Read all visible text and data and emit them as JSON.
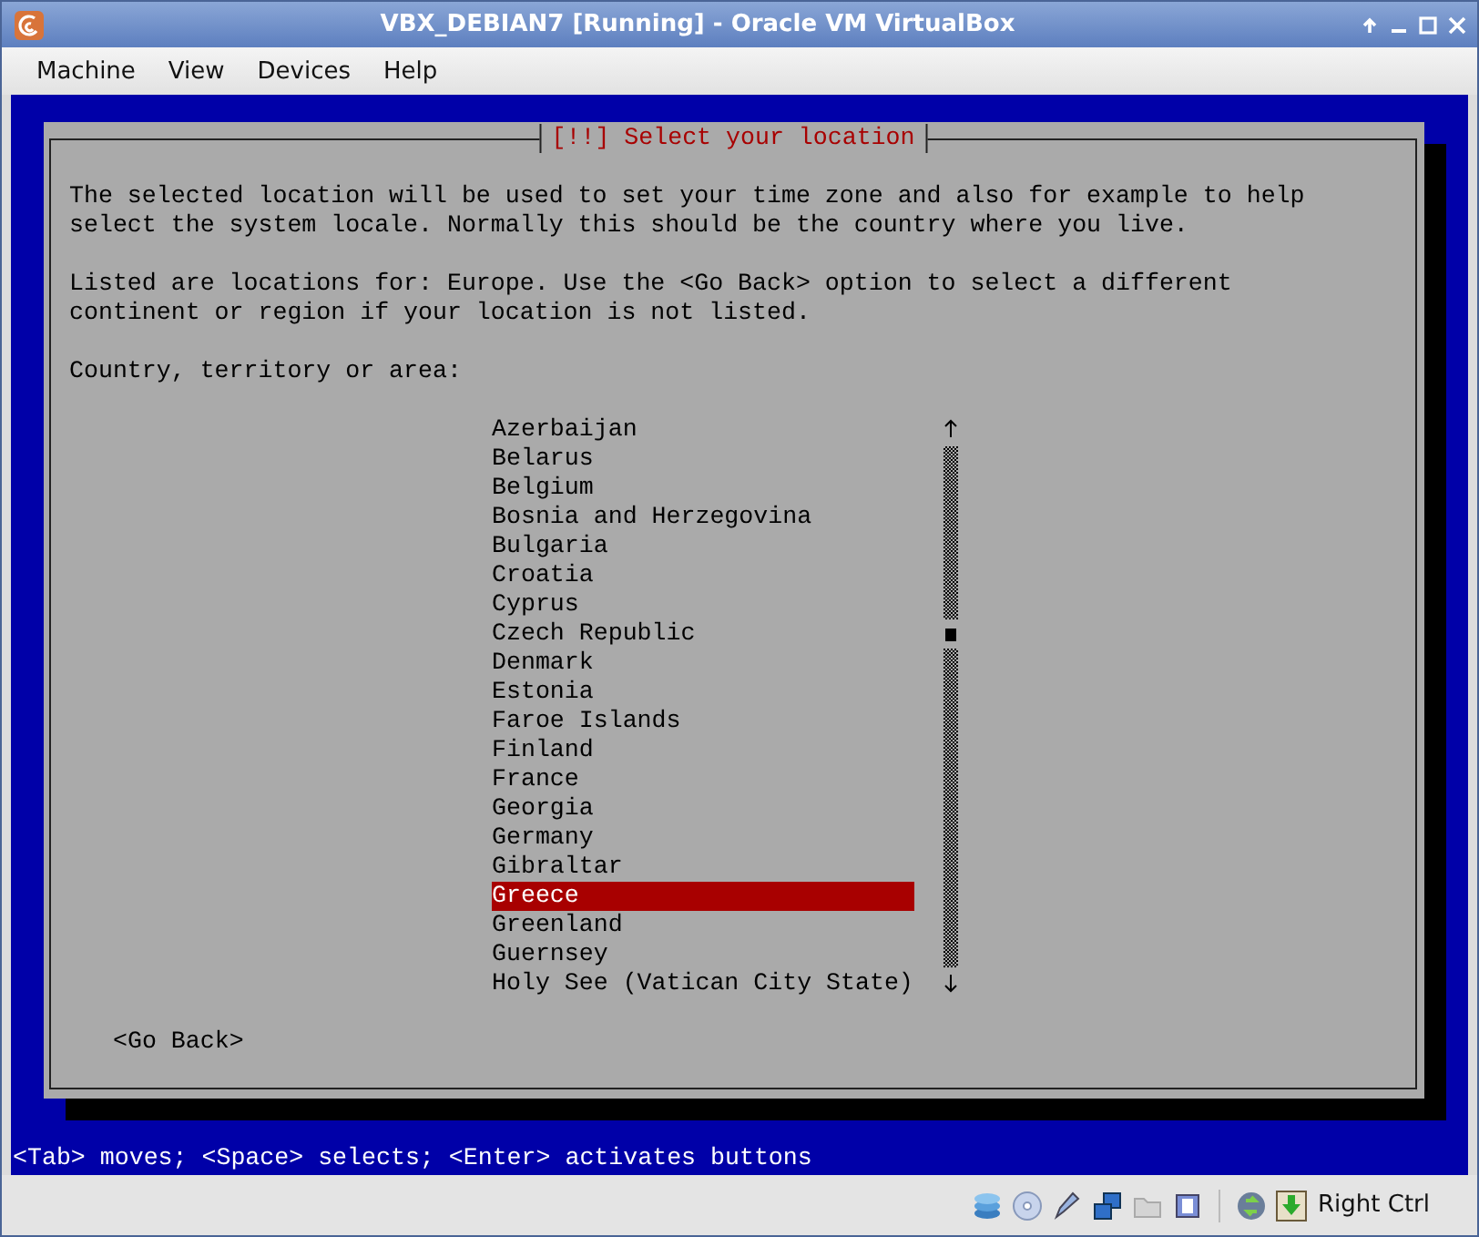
{
  "window": {
    "title": "VBX_DEBIAN7 [Running] - Oracle VM VirtualBox"
  },
  "menu": [
    "Machine",
    "View",
    "Devices",
    "Help"
  ],
  "dialog": {
    "title": "[!!] Select your location",
    "paragraphs": [
      "The selected location will be used to set your time zone and also for example to help\nselect the system locale. Normally this should be the country where you live.",
      "Listed are locations for: Europe. Use the <Go Back> option to select a different\ncontinent or region if your location is not listed."
    ],
    "prompt": "Country, territory or area:",
    "items": [
      {
        "label": "Azerbaijan",
        "selected": false
      },
      {
        "label": "Belarus",
        "selected": false
      },
      {
        "label": "Belgium",
        "selected": false
      },
      {
        "label": "Bosnia and Herzegovina",
        "selected": false
      },
      {
        "label": "Bulgaria",
        "selected": false
      },
      {
        "label": "Croatia",
        "selected": false
      },
      {
        "label": "Cyprus",
        "selected": false
      },
      {
        "label": "Czech Republic",
        "selected": false
      },
      {
        "label": "Denmark",
        "selected": false
      },
      {
        "label": "Estonia",
        "selected": false
      },
      {
        "label": "Faroe Islands",
        "selected": false
      },
      {
        "label": "Finland",
        "selected": false
      },
      {
        "label": "France",
        "selected": false
      },
      {
        "label": "Georgia",
        "selected": false
      },
      {
        "label": "Germany",
        "selected": false
      },
      {
        "label": "Gibraltar",
        "selected": false
      },
      {
        "label": "Greece",
        "selected": true
      },
      {
        "label": "Greenland",
        "selected": false
      },
      {
        "label": "Guernsey",
        "selected": false
      },
      {
        "label": "Holy See (Vatican City State)",
        "selected": false
      }
    ],
    "back_button": "<Go Back>"
  },
  "help_line": "<Tab> moves; <Space> selects; <Enter> activates buttons",
  "status_bar": {
    "host_key": "Right Ctrl"
  }
}
